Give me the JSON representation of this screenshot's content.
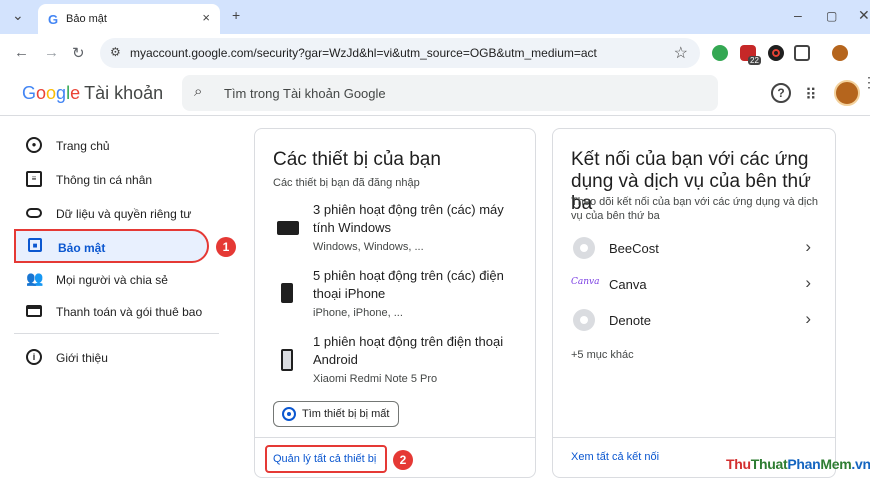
{
  "browser": {
    "tab_title": "Bảo mật",
    "tab_favicon": "G",
    "close_tab": "×",
    "new_tab": "+",
    "url": "myaccount.google.com/security?gar=WzJd&hl=vi&utm_source=OGB&utm_medium=act",
    "extension_badge": "22",
    "window_controls": [
      "–",
      "▢",
      "✕"
    ]
  },
  "header": {
    "brand_letters": [
      {
        "ch": "G",
        "color": "#4285f4"
      },
      {
        "ch": "o",
        "color": "#ea4335"
      },
      {
        "ch": "o",
        "color": "#fbbc05"
      },
      {
        "ch": "g",
        "color": "#4285f4"
      },
      {
        "ch": "l",
        "color": "#34a853"
      },
      {
        "ch": "e",
        "color": "#ea4335"
      }
    ],
    "account_label": "Tài khoản",
    "search_placeholder": "Tìm trong Tài khoản Google"
  },
  "sidebar": {
    "items": [
      {
        "label": "Trang chủ",
        "icon": "home-icon"
      },
      {
        "label": "Thông tin cá nhân",
        "icon": "id-card-icon"
      },
      {
        "label": "Dữ liệu và quyền riêng tư",
        "icon": "toggle-icon"
      },
      {
        "label": "Bảo mật",
        "icon": "lock-icon",
        "active": true
      },
      {
        "label": "Mọi người và chia sẻ",
        "icon": "people-icon"
      },
      {
        "label": "Thanh toán và gói thuê bao",
        "icon": "credit-card-icon"
      },
      {
        "label": "Giới thiệu",
        "icon": "info-icon"
      }
    ],
    "step_badge": "1"
  },
  "devices_card": {
    "title": "Các thiết bị của bạn",
    "subtitle": "Các thiết bị bạn đã đăng nhập",
    "devices": [
      {
        "title": "3 phiên hoạt động trên (các) máy tính Windows",
        "detail": "Windows, Windows, ...",
        "icon": "windows-laptop-icon"
      },
      {
        "title": "5 phiên hoạt động trên (các) điện thoại iPhone",
        "detail": "iPhone, iPhone, ...",
        "icon": "iphone-icon"
      },
      {
        "title": "1 phiên hoạt động trên điện thoại Android",
        "detail": "Xiaomi Redmi Note 5 Pro",
        "icon": "android-phone-icon"
      }
    ],
    "find_button": "Tìm thiết bị bị mất",
    "manage_link": "Quản lý tất cả thiết bị",
    "step_badge": "2"
  },
  "apps_card": {
    "title": "Kết nối của bạn với các ứng dụng và dịch vụ của bên thứ ba",
    "subtitle": "Theo dõi kết nối của bạn với các ứng dụng và dịch vụ của bên thứ ba",
    "apps": [
      {
        "name": "BeeCost",
        "logo": "generic"
      },
      {
        "name": "Canva",
        "logo": "canva",
        "logo_text": "Canva"
      },
      {
        "name": "Denote",
        "logo": "generic"
      }
    ],
    "more": "+5 mục khác",
    "see_all": "Xem tất cả kết nối"
  },
  "watermark": {
    "parts": [
      {
        "text": "Thu",
        "color": "#d32f2f"
      },
      {
        "text": "Thuat",
        "color": "#2e7d32"
      },
      {
        "text": "Phan",
        "color": "#1565c0"
      },
      {
        "text": "Mem",
        "color": "#2e7d32"
      },
      {
        "text": ".vn",
        "color": "#1565c0"
      }
    ]
  },
  "colors": {
    "accent": "#0b57d0",
    "highlight": "#e53935",
    "active_bg": "#e8f0fe"
  }
}
